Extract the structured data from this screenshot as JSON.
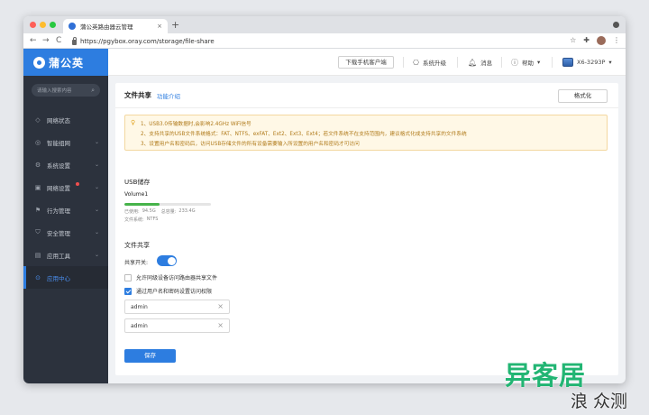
{
  "browser": {
    "tab_title": "蒲公英路由器云管理",
    "tab_close": "×",
    "new_tab": "+",
    "url": "https://pgybox.oray.com/storage/file-share",
    "back": "←",
    "forward": "→",
    "reload": "C"
  },
  "header": {
    "logo": "蒲公英",
    "download_label": "下载手机客户端",
    "upgrade_label": "系统升级",
    "messages_label": "消息",
    "help_label": "帮助",
    "device_name": "X6-3293P",
    "dropdown_glyph": "▾"
  },
  "sidebar": {
    "search_placeholder": "请输入搜索内容",
    "items": [
      {
        "label": "网络状态"
      },
      {
        "label": "智能组网"
      },
      {
        "label": "系统设置"
      },
      {
        "label": "网络设置"
      },
      {
        "label": "行为管理"
      },
      {
        "label": "安全管理"
      },
      {
        "label": "应用工具"
      },
      {
        "label": "应用中心"
      }
    ],
    "chevron": "⌄"
  },
  "page": {
    "title": "文件共享",
    "intro_link": "功能介绍",
    "format_button": "格式化",
    "notice_lines": [
      "1、USB3.0传输数据时,会影响2.4GHz WiFi信号",
      "2、支持共享的USB文件系统格式：FAT、NTFS、exFAT、Ext2、Ext3、Ext4；若文件系统不在支持范围内，建议格式化成支持共享的文件系统",
      "3、设置用户名和密码后，访问USB存储文件的所有设备需要输入所设置的用户名和密码才可访问"
    ],
    "usb_section_title": "USB储存",
    "volume": {
      "name": "Volume1",
      "used_label": "已使用:",
      "used": "94.5G",
      "total_label": "总容量:",
      "total": "233.4G",
      "used_gb": 94.5,
      "total_gb": 233.4,
      "fs_label": "文件系统:",
      "fs": "NTFS"
    },
    "share_section_title": "文件共享",
    "share_switch_label": "共享开关:",
    "share_enabled": true,
    "option_same_level": {
      "label": "允许同级设备访问路由器共享文件",
      "checked": false
    },
    "option_auth": {
      "label": "通过用户名和密码设置访问权限",
      "checked": true
    },
    "username_value": "admin",
    "password_value": "admin",
    "clear_glyph": "×",
    "save_button": "保存"
  },
  "colors": {
    "accent": "#2d7de0",
    "usage_bar": "#46b34a",
    "sidebar_bg": "#2c323d",
    "notice_bg": "#fff8e6"
  },
  "watermark": {
    "main": "异客居",
    "sub": "浪 众测"
  }
}
